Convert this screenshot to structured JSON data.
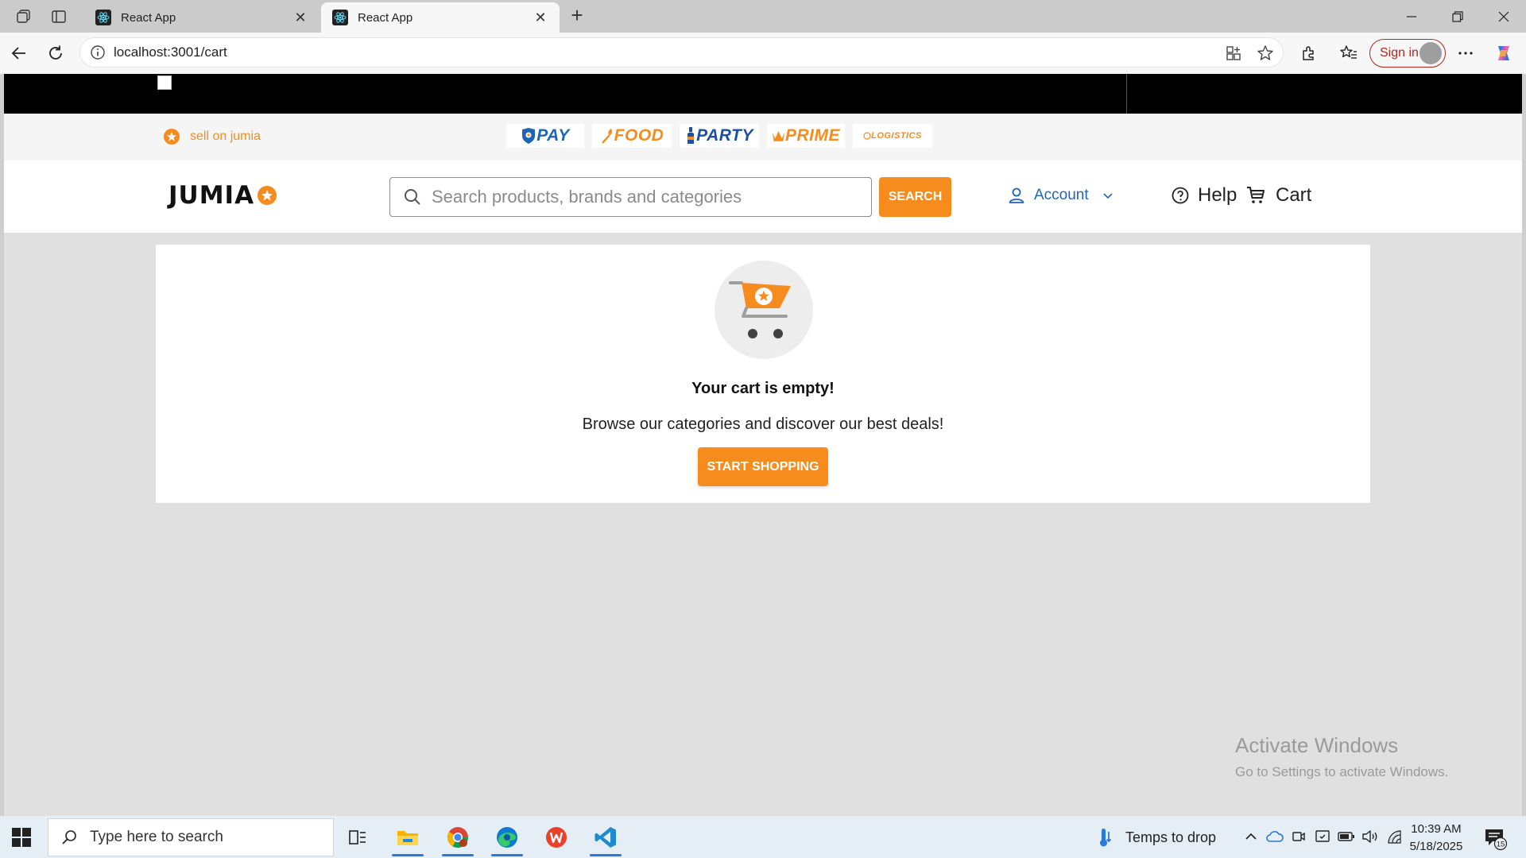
{
  "browser": {
    "tabs": [
      {
        "title": "React App",
        "active": false
      },
      {
        "title": "React App",
        "active": true
      }
    ],
    "url": "localhost:3001/cart",
    "sign_in_label": "Sign in"
  },
  "site": {
    "sell_label": "sell on jumia",
    "brands": [
      {
        "name": "pay",
        "label": "PAY"
      },
      {
        "name": "food",
        "label": "FOOD"
      },
      {
        "name": "party",
        "label": "PARTY"
      },
      {
        "name": "prime",
        "label": "PRIME"
      },
      {
        "name": "logistics",
        "label": "LOGISTICS"
      }
    ],
    "logo_text": "JUMIA",
    "search_placeholder": "Search products, brands and categories",
    "search_button": "SEARCH",
    "account_label": "Account",
    "help_label": "Help",
    "cart_label": "Cart",
    "accent_color": "#f68b1e",
    "link_color": "#1f65b7"
  },
  "cart": {
    "empty_title": "Your cart is empty!",
    "empty_subtitle": "Browse our categories and discover our best deals!",
    "start_button": "START SHOPPING"
  },
  "watermark": {
    "line1": "Activate Windows",
    "line2": "Go to Settings to activate Windows."
  },
  "taskbar": {
    "search_placeholder": "Type here to search",
    "weather": "Temps to drop",
    "time": "10:39 AM",
    "date": "5/18/2025",
    "notification_count": "15"
  }
}
